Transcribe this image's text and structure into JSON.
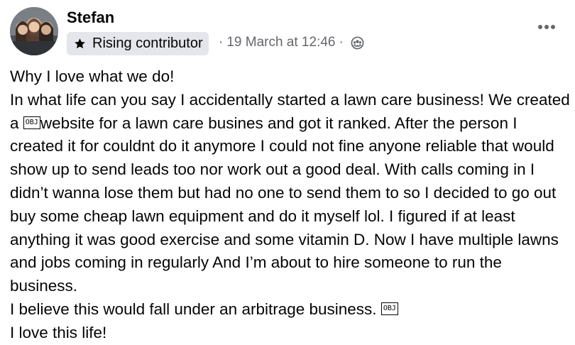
{
  "author": {
    "name": "Stefan",
    "badge": "Rising contributor",
    "badge_icon": "star-icon",
    "timestamp": "19 March at 12:46",
    "separator": "·",
    "privacy_icon": "group-members-icon"
  },
  "menu": {
    "icon": "more-options-icon"
  },
  "post": {
    "line1": "Why I love what we do!",
    "para2_before": "In what life can you say I accidentally started a lawn care business! We created a ",
    "obj_glyph": "OBJ",
    "para2_after": "website for a lawn care busines and got it ranked. After the person I created it for couldnt do it anymore I could not fine anyone reliable that would show up to send leads too nor work out a good deal. With calls coming in I didn’t wanna lose them but had no one to send them to so I decided to go out buy some cheap lawn equipment and do it myself lol. I figured if at least anything it was good exercise and some vitamin D. Now I have multiple lawns and jobs coming in regularly And I’m about to hire someone to run the business.",
    "para3": "I believe this would fall under an arbitrage business. ",
    "line4": "I love this life!"
  },
  "colors": {
    "text": "#050505",
    "secondary_text": "#65676b",
    "badge_bg": "#e4e6eb"
  }
}
